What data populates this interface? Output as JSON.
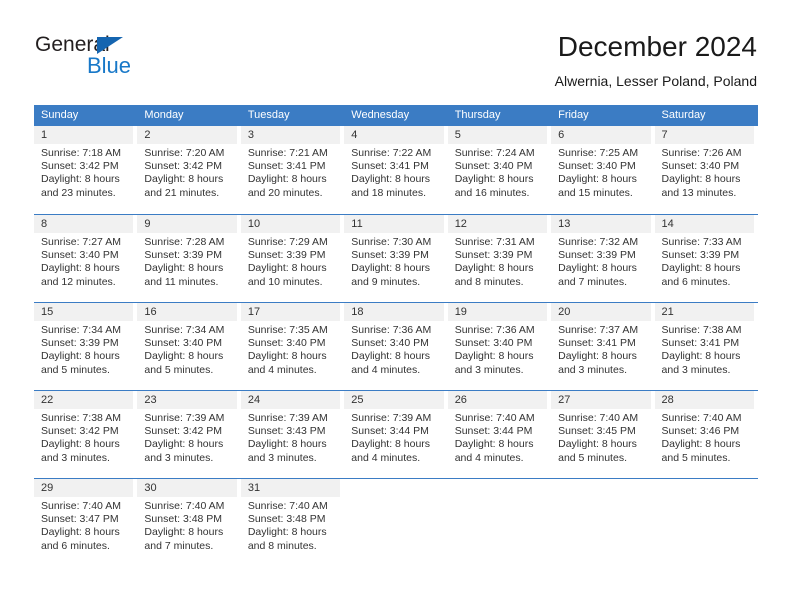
{
  "logo": {
    "word_one": "General",
    "word_two": "Blue",
    "triangle_color": "#1565b0",
    "blue_color": "#1878c8"
  },
  "header": {
    "title": "December 2024",
    "subtitle": "Alwernia, Lesser Poland, Poland"
  },
  "theme": {
    "header_blue": "#3b7cc4",
    "daynum_gray": "#f1f1f1",
    "text": "#333333"
  },
  "weekdays": [
    "Sunday",
    "Monday",
    "Tuesday",
    "Wednesday",
    "Thursday",
    "Friday",
    "Saturday"
  ],
  "days": [
    {
      "n": "1",
      "sunrise": "Sunrise: 7:18 AM",
      "sunset": "Sunset: 3:42 PM",
      "d1": "Daylight: 8 hours",
      "d2": "and 23 minutes."
    },
    {
      "n": "2",
      "sunrise": "Sunrise: 7:20 AM",
      "sunset": "Sunset: 3:42 PM",
      "d1": "Daylight: 8 hours",
      "d2": "and 21 minutes."
    },
    {
      "n": "3",
      "sunrise": "Sunrise: 7:21 AM",
      "sunset": "Sunset: 3:41 PM",
      "d1": "Daylight: 8 hours",
      "d2": "and 20 minutes."
    },
    {
      "n": "4",
      "sunrise": "Sunrise: 7:22 AM",
      "sunset": "Sunset: 3:41 PM",
      "d1": "Daylight: 8 hours",
      "d2": "and 18 minutes."
    },
    {
      "n": "5",
      "sunrise": "Sunrise: 7:24 AM",
      "sunset": "Sunset: 3:40 PM",
      "d1": "Daylight: 8 hours",
      "d2": "and 16 minutes."
    },
    {
      "n": "6",
      "sunrise": "Sunrise: 7:25 AM",
      "sunset": "Sunset: 3:40 PM",
      "d1": "Daylight: 8 hours",
      "d2": "and 15 minutes."
    },
    {
      "n": "7",
      "sunrise": "Sunrise: 7:26 AM",
      "sunset": "Sunset: 3:40 PM",
      "d1": "Daylight: 8 hours",
      "d2": "and 13 minutes."
    },
    {
      "n": "8",
      "sunrise": "Sunrise: 7:27 AM",
      "sunset": "Sunset: 3:40 PM",
      "d1": "Daylight: 8 hours",
      "d2": "and 12 minutes."
    },
    {
      "n": "9",
      "sunrise": "Sunrise: 7:28 AM",
      "sunset": "Sunset: 3:39 PM",
      "d1": "Daylight: 8 hours",
      "d2": "and 11 minutes."
    },
    {
      "n": "10",
      "sunrise": "Sunrise: 7:29 AM",
      "sunset": "Sunset: 3:39 PM",
      "d1": "Daylight: 8 hours",
      "d2": "and 10 minutes."
    },
    {
      "n": "11",
      "sunrise": "Sunrise: 7:30 AM",
      "sunset": "Sunset: 3:39 PM",
      "d1": "Daylight: 8 hours",
      "d2": "and 9 minutes."
    },
    {
      "n": "12",
      "sunrise": "Sunrise: 7:31 AM",
      "sunset": "Sunset: 3:39 PM",
      "d1": "Daylight: 8 hours",
      "d2": "and 8 minutes."
    },
    {
      "n": "13",
      "sunrise": "Sunrise: 7:32 AM",
      "sunset": "Sunset: 3:39 PM",
      "d1": "Daylight: 8 hours",
      "d2": "and 7 minutes."
    },
    {
      "n": "14",
      "sunrise": "Sunrise: 7:33 AM",
      "sunset": "Sunset: 3:39 PM",
      "d1": "Daylight: 8 hours",
      "d2": "and 6 minutes."
    },
    {
      "n": "15",
      "sunrise": "Sunrise: 7:34 AM",
      "sunset": "Sunset: 3:39 PM",
      "d1": "Daylight: 8 hours",
      "d2": "and 5 minutes."
    },
    {
      "n": "16",
      "sunrise": "Sunrise: 7:34 AM",
      "sunset": "Sunset: 3:40 PM",
      "d1": "Daylight: 8 hours",
      "d2": "and 5 minutes."
    },
    {
      "n": "17",
      "sunrise": "Sunrise: 7:35 AM",
      "sunset": "Sunset: 3:40 PM",
      "d1": "Daylight: 8 hours",
      "d2": "and 4 minutes."
    },
    {
      "n": "18",
      "sunrise": "Sunrise: 7:36 AM",
      "sunset": "Sunset: 3:40 PM",
      "d1": "Daylight: 8 hours",
      "d2": "and 4 minutes."
    },
    {
      "n": "19",
      "sunrise": "Sunrise: 7:36 AM",
      "sunset": "Sunset: 3:40 PM",
      "d1": "Daylight: 8 hours",
      "d2": "and 3 minutes."
    },
    {
      "n": "20",
      "sunrise": "Sunrise: 7:37 AM",
      "sunset": "Sunset: 3:41 PM",
      "d1": "Daylight: 8 hours",
      "d2": "and 3 minutes."
    },
    {
      "n": "21",
      "sunrise": "Sunrise: 7:38 AM",
      "sunset": "Sunset: 3:41 PM",
      "d1": "Daylight: 8 hours",
      "d2": "and 3 minutes."
    },
    {
      "n": "22",
      "sunrise": "Sunrise: 7:38 AM",
      "sunset": "Sunset: 3:42 PM",
      "d1": "Daylight: 8 hours",
      "d2": "and 3 minutes."
    },
    {
      "n": "23",
      "sunrise": "Sunrise: 7:39 AM",
      "sunset": "Sunset: 3:42 PM",
      "d1": "Daylight: 8 hours",
      "d2": "and 3 minutes."
    },
    {
      "n": "24",
      "sunrise": "Sunrise: 7:39 AM",
      "sunset": "Sunset: 3:43 PM",
      "d1": "Daylight: 8 hours",
      "d2": "and 3 minutes."
    },
    {
      "n": "25",
      "sunrise": "Sunrise: 7:39 AM",
      "sunset": "Sunset: 3:44 PM",
      "d1": "Daylight: 8 hours",
      "d2": "and 4 minutes."
    },
    {
      "n": "26",
      "sunrise": "Sunrise: 7:40 AM",
      "sunset": "Sunset: 3:44 PM",
      "d1": "Daylight: 8 hours",
      "d2": "and 4 minutes."
    },
    {
      "n": "27",
      "sunrise": "Sunrise: 7:40 AM",
      "sunset": "Sunset: 3:45 PM",
      "d1": "Daylight: 8 hours",
      "d2": "and 5 minutes."
    },
    {
      "n": "28",
      "sunrise": "Sunrise: 7:40 AM",
      "sunset": "Sunset: 3:46 PM",
      "d1": "Daylight: 8 hours",
      "d2": "and 5 minutes."
    },
    {
      "n": "29",
      "sunrise": "Sunrise: 7:40 AM",
      "sunset": "Sunset: 3:47 PM",
      "d1": "Daylight: 8 hours",
      "d2": "and 6 minutes."
    },
    {
      "n": "30",
      "sunrise": "Sunrise: 7:40 AM",
      "sunset": "Sunset: 3:48 PM",
      "d1": "Daylight: 8 hours",
      "d2": "and 7 minutes."
    },
    {
      "n": "31",
      "sunrise": "Sunrise: 7:40 AM",
      "sunset": "Sunset: 3:48 PM",
      "d1": "Daylight: 8 hours",
      "d2": "and 8 minutes."
    }
  ],
  "grid": {
    "lead_blank": 0,
    "weeks": 5
  }
}
